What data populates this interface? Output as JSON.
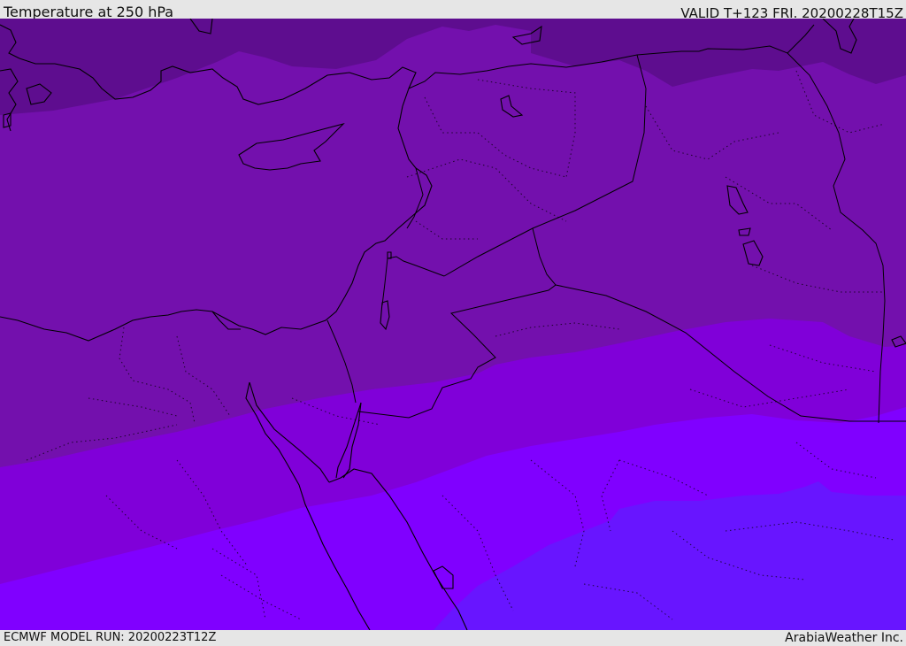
{
  "header": {
    "title": "Temperature at 250 hPa",
    "valid": "VALID T+123 FRI. 20200228T15Z"
  },
  "footer": {
    "model_run": "ECMWF MODEL RUN: 20200223T12Z",
    "credit": "ArabiaWeather Inc."
  },
  "map": {
    "variable": "Temperature",
    "level": "250 hPa",
    "region": "Eastern Mediterranean / Middle East",
    "colors": {
      "band_darkest": "#5e0d8f",
      "band_dark": "#7310ad",
      "band_mid": "#8000d9",
      "band_bright": "#8000ff",
      "band_blue_violet": "#6815ff",
      "coastline": "#000000",
      "borders": "#000000"
    },
    "overlays": [
      "coastlines",
      "country-borders",
      "province-borders-dotted"
    ]
  }
}
